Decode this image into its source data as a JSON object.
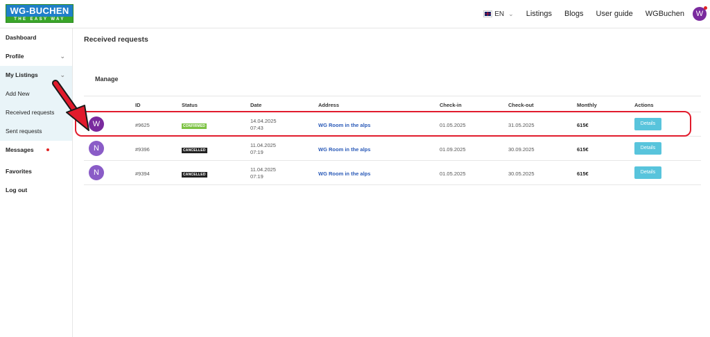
{
  "header": {
    "logo_top": "WG-BUCHEN",
    "logo_bottom": "THE EASY WAY",
    "language": "EN",
    "nav": [
      "Listings",
      "Blogs",
      "User guide",
      "WGBuchen"
    ],
    "avatar_letter": "W"
  },
  "sidebar": {
    "items": [
      {
        "label": "Dashboard"
      },
      {
        "label": "Profile"
      },
      {
        "label": "My Listings"
      },
      {
        "label": "Add New"
      },
      {
        "label": "Received requests"
      },
      {
        "label": "Sent requests"
      },
      {
        "label": "Messages"
      },
      {
        "label": "Favorites"
      },
      {
        "label": "Log out"
      }
    ]
  },
  "main": {
    "page_title": "Received requests",
    "section_title": "Manage",
    "columns": [
      "ID",
      "Status",
      "Date",
      "Address",
      "Check-in",
      "Check-out",
      "Monthly",
      "Actions"
    ],
    "rows": [
      {
        "avatar": "W",
        "avatar_color": "#7a2a9e",
        "id": "#9625",
        "status": "CONFIRMED",
        "status_color": "#7cc242",
        "date": "14.04.2025",
        "time": "07:43",
        "address": "WG Room in the alps",
        "check_in": "01.05.2025",
        "check_out": "31.05.2025",
        "monthly": "615€",
        "action": "Details"
      },
      {
        "avatar": "N",
        "avatar_color": "#8a5cc7",
        "id": "#9396",
        "status": "CANCELLED",
        "status_color": "#222222",
        "date": "11.04.2025",
        "time": "07:19",
        "address": "WG Room in the alps",
        "check_in": "01.09.2025",
        "check_out": "30.09.2025",
        "monthly": "615€",
        "action": "Details"
      },
      {
        "avatar": "N",
        "avatar_color": "#8a5cc7",
        "id": "#9394",
        "status": "CANCELLED",
        "status_color": "#222222",
        "date": "11.04.2025",
        "time": "07:19",
        "address": "WG Room in the alps",
        "check_in": "01.05.2025",
        "check_out": "30.05.2025",
        "monthly": "615€",
        "action": "Details"
      }
    ]
  },
  "colors": {
    "accent": "#58c4dc",
    "highlight": "#e11b2c"
  }
}
